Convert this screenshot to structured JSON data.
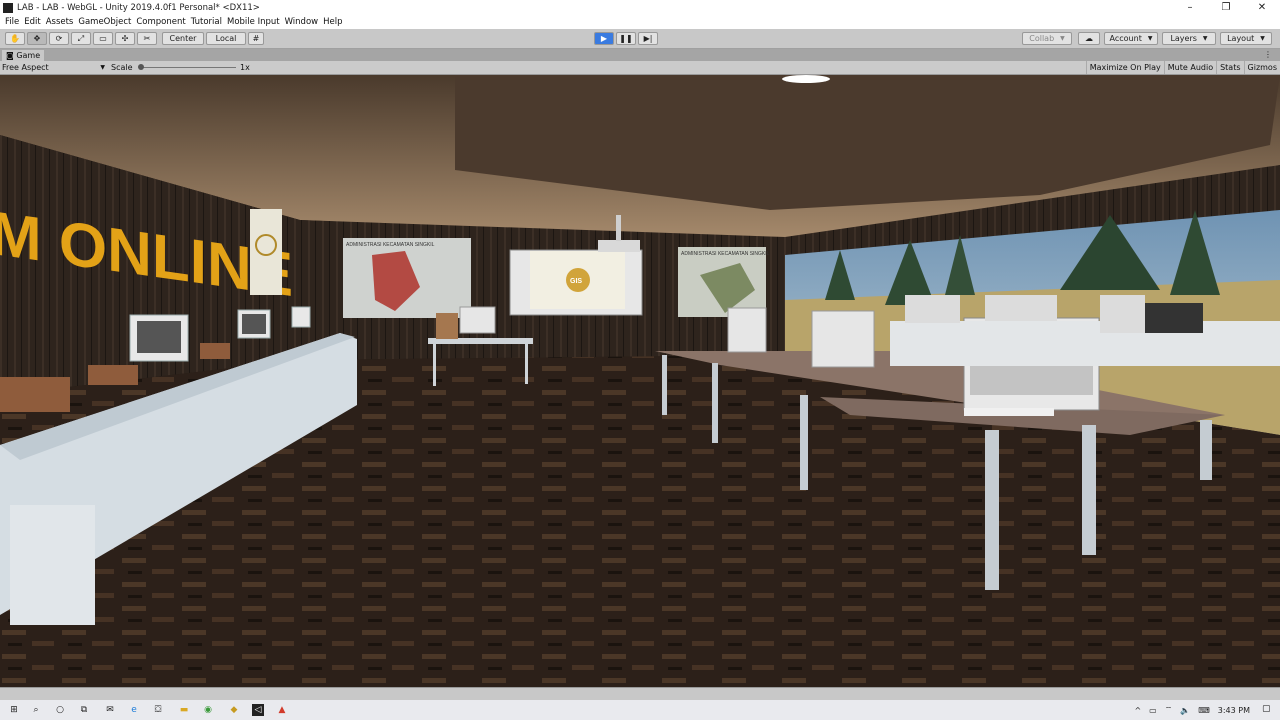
{
  "window": {
    "title": "LAB - LAB - WebGL - Unity 2019.4.0f1 Personal* <DX11>",
    "controls": {
      "minimize": "–",
      "maximize": "❐",
      "close": "✕"
    }
  },
  "menu": [
    "File",
    "Edit",
    "Assets",
    "GameObject",
    "Component",
    "Tutorial",
    "Mobile Input",
    "Window",
    "Help"
  ],
  "toolbar": {
    "center_label": "Center",
    "local_label": "Local",
    "collab_label": "Collab",
    "account_label": "Account",
    "layers_label": "Layers",
    "layout_label": "Layout"
  },
  "game_tab": {
    "label": "Game",
    "menu_glyph": "⋮"
  },
  "game_view": {
    "aspect": "Free Aspect",
    "scale_label": "Scale",
    "scale_value": "1x",
    "options": [
      "Maximize On Play",
      "Mute Audio",
      "Stats",
      "Gizmos"
    ]
  },
  "scene": {
    "wall_sign": "M ONLINE",
    "poster_left": "ADMINISTRASI KECAMATAN SINGKIL",
    "poster_right": "ADMINISTRASI KECAMATAN SINGKIL",
    "screen_label": "GIS"
  },
  "taskbar": {
    "time": "3:43 PM"
  },
  "colors": {
    "play_button": "#3a7be0",
    "sign_text": "#e3a217",
    "floor": "#2a1d16"
  }
}
